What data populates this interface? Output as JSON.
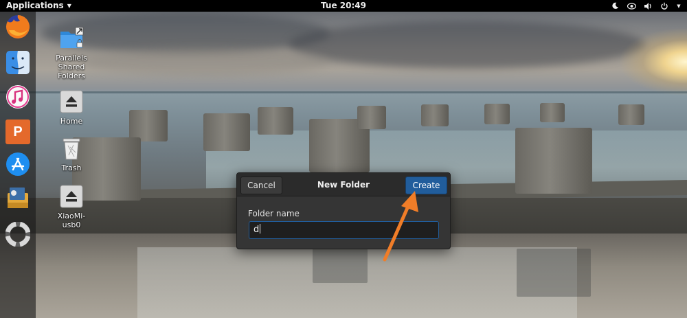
{
  "top_bar": {
    "applications_label": "Applications",
    "clock": "Tue 20:49",
    "tray_icons": [
      "night-light-icon",
      "network-icon",
      "volume-icon",
      "power-icon"
    ]
  },
  "dock": {
    "items": [
      {
        "name": "firefox",
        "icon": "firefox-icon"
      },
      {
        "name": "finder",
        "icon": "finder-icon"
      },
      {
        "name": "itunes",
        "icon": "music-icon"
      },
      {
        "name": "wps-presentation",
        "icon": "presentation-icon",
        "glyph": "P"
      },
      {
        "name": "app-store",
        "icon": "app-store-icon"
      },
      {
        "name": "preview",
        "icon": "preview-icon"
      },
      {
        "name": "help",
        "icon": "lifebuoy-icon"
      }
    ]
  },
  "desktop": {
    "icons": [
      {
        "label": "Parallels\nShared\nFolders",
        "icon": "shared-folder-icon"
      },
      {
        "label": "Home",
        "icon": "eject-icon"
      },
      {
        "label": "Trash",
        "icon": "trash-icon"
      },
      {
        "label": "XiaoMi-\nusb0",
        "icon": "eject-icon"
      }
    ]
  },
  "dialog": {
    "title": "New Folder",
    "cancel_label": "Cancel",
    "create_label": "Create",
    "field_label": "Folder name",
    "field_value": "d"
  },
  "colors": {
    "accent": "#215d9c",
    "annotation_arrow": "#f07d28",
    "panel": "#000000",
    "dialog_bg": "#353535"
  }
}
